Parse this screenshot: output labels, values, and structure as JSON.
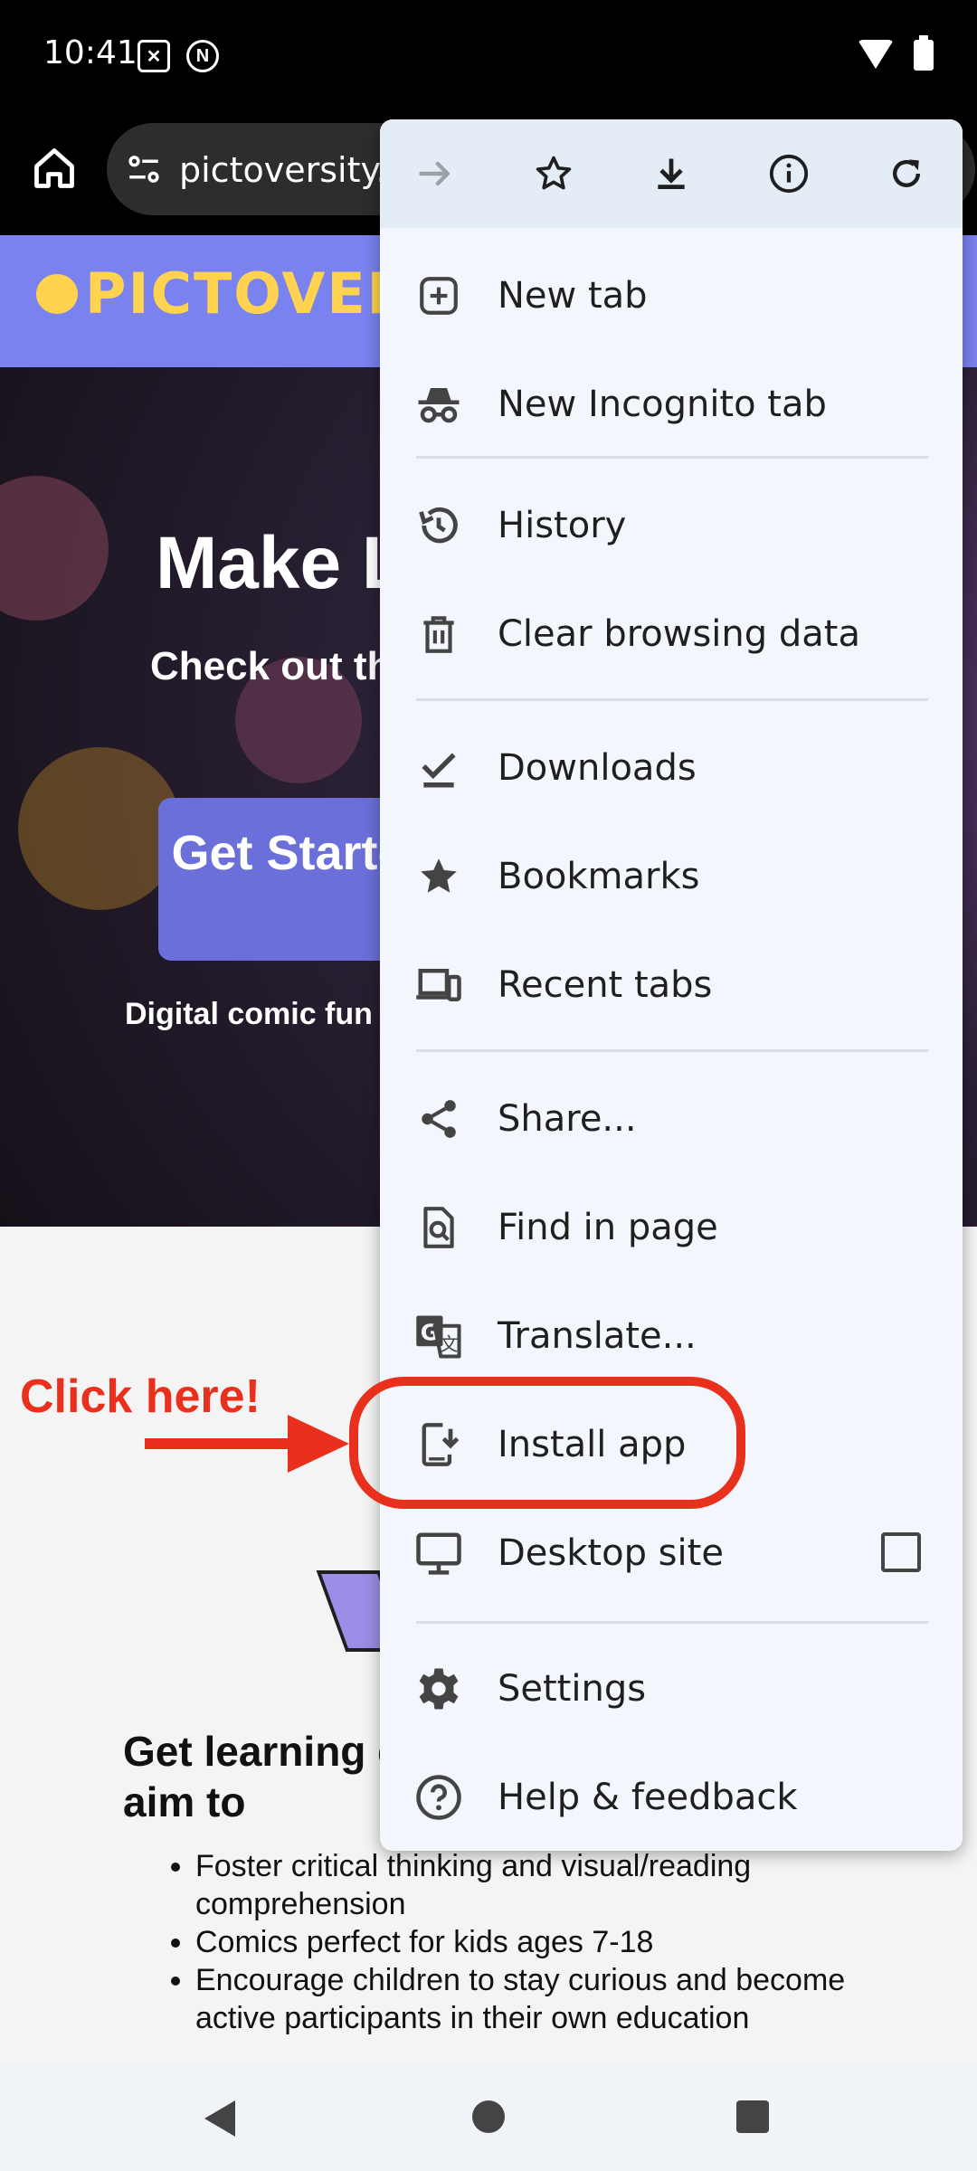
{
  "status_bar": {
    "time": "10:41"
  },
  "toolbar": {
    "url": "pictoversity.com"
  },
  "site": {
    "logo_text": "PICTOVERSITY"
  },
  "hero": {
    "title": "Make Learning Fun",
    "subtitle": "Check out these comics",
    "cta_label": "Get Started",
    "footnote": "Digital comic fun for all"
  },
  "annotation": {
    "callout": "Click here!"
  },
  "content": {
    "heading": "Get learning excited with comics! We aim to",
    "bullets": [
      "Foster critical thinking and visual/reading comprehension",
      "Comics perfect for kids ages 7-18",
      "Encourage children to stay curious and become active participants in their own education"
    ]
  },
  "menu": {
    "top_icons": [
      "forward-icon",
      "bookmark-star-icon",
      "download-icon",
      "info-icon",
      "reload-icon"
    ],
    "items": [
      {
        "label": "New tab",
        "icon": "new-tab-icon"
      },
      {
        "label": "New Incognito tab",
        "icon": "incognito-icon"
      },
      {
        "label": "History",
        "icon": "history-icon"
      },
      {
        "label": "Clear browsing data",
        "icon": "trash-icon"
      },
      {
        "label": "Downloads",
        "icon": "downloads-icon"
      },
      {
        "label": "Bookmarks",
        "icon": "bookmarks-star-icon"
      },
      {
        "label": "Recent tabs",
        "icon": "recent-tabs-icon"
      },
      {
        "label": "Share...",
        "icon": "share-icon"
      },
      {
        "label": "Find in page",
        "icon": "find-in-page-icon"
      },
      {
        "label": "Translate...",
        "icon": "translate-icon"
      },
      {
        "label": "Install app",
        "icon": "install-app-icon"
      },
      {
        "label": "Desktop site",
        "icon": "desktop-icon"
      },
      {
        "label": "Settings",
        "icon": "settings-gear-icon"
      },
      {
        "label": "Help & feedback",
        "icon": "help-icon"
      }
    ],
    "desktop_site_checked": false
  },
  "colors": {
    "accent": "#e8301c",
    "site_header": "#7a82ef",
    "logo": "#ffd34f",
    "menu_bg": "#f3f6fc"
  }
}
